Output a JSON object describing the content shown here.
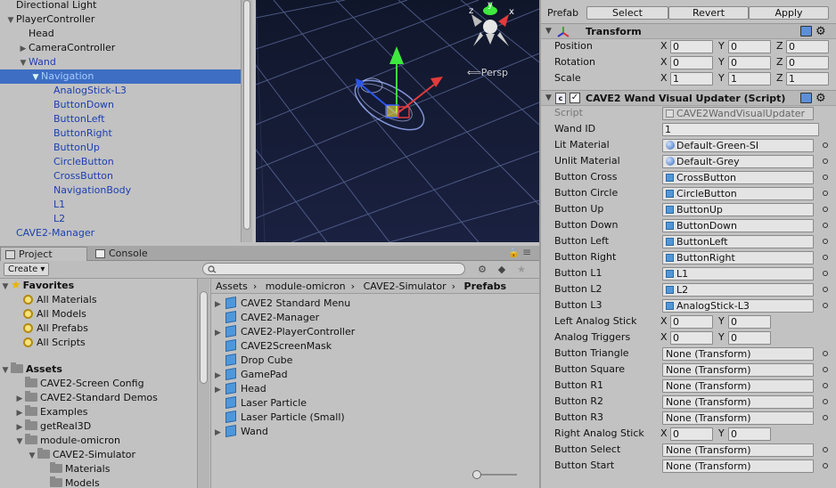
{
  "hierarchy": {
    "items": [
      {
        "label": "Directional Light",
        "indent": 0,
        "arrow": "",
        "selected": false,
        "blue": false
      },
      {
        "label": "PlayerController",
        "indent": 0,
        "arrow": "▼",
        "selected": false,
        "blue": false
      },
      {
        "label": "Head",
        "indent": 1,
        "arrow": "",
        "selected": false,
        "blue": false
      },
      {
        "label": "CameraController",
        "indent": 1,
        "arrow": "▶",
        "selected": false,
        "blue": false
      },
      {
        "label": "Wand",
        "indent": 1,
        "arrow": "▼",
        "selected": false,
        "blue": true
      },
      {
        "label": "Navigation",
        "indent": 2,
        "arrow": "▼",
        "selected": true,
        "blue": true
      },
      {
        "label": "AnalogStick-L3",
        "indent": 3,
        "arrow": "",
        "selected": false,
        "blue": true
      },
      {
        "label": "ButtonDown",
        "indent": 3,
        "arrow": "",
        "selected": false,
        "blue": true
      },
      {
        "label": "ButtonLeft",
        "indent": 3,
        "arrow": "",
        "selected": false,
        "blue": true
      },
      {
        "label": "ButtonRight",
        "indent": 3,
        "arrow": "",
        "selected": false,
        "blue": true
      },
      {
        "label": "ButtonUp",
        "indent": 3,
        "arrow": "",
        "selected": false,
        "blue": true
      },
      {
        "label": "CircleButton",
        "indent": 3,
        "arrow": "",
        "selected": false,
        "blue": true
      },
      {
        "label": "CrossButton",
        "indent": 3,
        "arrow": "",
        "selected": false,
        "blue": true
      },
      {
        "label": "NavigationBody",
        "indent": 3,
        "arrow": "",
        "selected": false,
        "blue": true
      },
      {
        "label": "L1",
        "indent": 3,
        "arrow": "",
        "selected": false,
        "blue": true
      },
      {
        "label": "L2",
        "indent": 3,
        "arrow": "",
        "selected": false,
        "blue": true
      },
      {
        "label": "CAVE2-Manager",
        "indent": 0,
        "arrow": "",
        "selected": false,
        "blue": true
      }
    ]
  },
  "scene": {
    "persp_label": "Persp",
    "gizmo_y": "y",
    "gizmo_x": "x",
    "gizmo_z": "z"
  },
  "project": {
    "tabs": {
      "project": "Project",
      "console": "Console"
    },
    "create_label": "Create",
    "favorites": {
      "title": "Favorites",
      "items": [
        "All Materials",
        "All Models",
        "All Prefabs",
        "All Scripts"
      ]
    },
    "assets": {
      "title": "Assets",
      "items": [
        {
          "label": "CAVE2-Screen Config",
          "indent": 1,
          "arrow": ""
        },
        {
          "label": "CAVE2-Standard Demos",
          "indent": 1,
          "arrow": "▶"
        },
        {
          "label": "Examples",
          "indent": 1,
          "arrow": "▶"
        },
        {
          "label": "getReal3D",
          "indent": 1,
          "arrow": "▶"
        },
        {
          "label": "module-omicron",
          "indent": 1,
          "arrow": "▼"
        },
        {
          "label": "CAVE2-Simulator",
          "indent": 2,
          "arrow": "▼"
        },
        {
          "label": "Materials",
          "indent": 3,
          "arrow": ""
        },
        {
          "label": "Models",
          "indent": 3,
          "arrow": ""
        }
      ]
    },
    "breadcrumb": [
      "Assets",
      "module-omicron",
      "CAVE2-Simulator",
      "Prefabs"
    ],
    "files": [
      {
        "label": "CAVE2 Standard Menu",
        "arrow": "▶"
      },
      {
        "label": "CAVE2-Manager",
        "arrow": ""
      },
      {
        "label": "CAVE2-PlayerController",
        "arrow": "▶"
      },
      {
        "label": "CAVE2ScreenMask",
        "arrow": ""
      },
      {
        "label": "Drop Cube",
        "arrow": ""
      },
      {
        "label": "GamePad",
        "arrow": "▶"
      },
      {
        "label": "Head",
        "arrow": "▶"
      },
      {
        "label": "Laser Particle",
        "arrow": ""
      },
      {
        "label": "Laser Particle (Small)",
        "arrow": ""
      },
      {
        "label": "Wand",
        "arrow": "▶"
      }
    ]
  },
  "inspector": {
    "prefab_label": "Prefab",
    "select_label": "Select",
    "revert_label": "Revert",
    "apply_label": "Apply",
    "transform": {
      "title": "Transform",
      "rows": [
        {
          "label": "Position",
          "x": "0",
          "y": "0",
          "z": "0"
        },
        {
          "label": "Rotation",
          "x": "0",
          "y": "0",
          "z": "0"
        },
        {
          "label": "Scale",
          "x": "1",
          "y": "1",
          "z": "1"
        }
      ]
    },
    "script_component": {
      "title": "CAVE2 Wand Visual Updater (Script)",
      "script_label": "Script",
      "script_value": "CAVE2WandVisualUpdater",
      "wand_id_label": "Wand ID",
      "wand_id_value": "1"
    },
    "fields": [
      {
        "label": "Lit Material",
        "value": "Default-Green-SI",
        "kind": "mat"
      },
      {
        "label": "Unlit Material",
        "value": "Default-Grey",
        "kind": "mat"
      },
      {
        "label": "Button Cross",
        "value": "CrossButton",
        "kind": "obj"
      },
      {
        "label": "Button Circle",
        "value": "CircleButton",
        "kind": "obj"
      },
      {
        "label": "Button Up",
        "value": "ButtonUp",
        "kind": "obj"
      },
      {
        "label": "Button Down",
        "value": "ButtonDown",
        "kind": "obj"
      },
      {
        "label": "Button Left",
        "value": "ButtonLeft",
        "kind": "obj"
      },
      {
        "label": "Button Right",
        "value": "ButtonRight",
        "kind": "obj"
      },
      {
        "label": "Button L1",
        "value": "L1",
        "kind": "obj"
      },
      {
        "label": "Button L2",
        "value": "L2",
        "kind": "obj"
      },
      {
        "label": "Button L3",
        "value": "AnalogStick-L3",
        "kind": "obj"
      },
      {
        "label": "Left Analog Stick",
        "x": "0",
        "y": "0",
        "kind": "vec"
      },
      {
        "label": "Analog Triggers",
        "x": "0",
        "y": "0",
        "kind": "vec"
      },
      {
        "label": "Button Triangle",
        "value": "None (Transform)",
        "kind": "none"
      },
      {
        "label": "Button Square",
        "value": "None (Transform)",
        "kind": "none"
      },
      {
        "label": "Button R1",
        "value": "None (Transform)",
        "kind": "none"
      },
      {
        "label": "Button R2",
        "value": "None (Transform)",
        "kind": "none"
      },
      {
        "label": "Button R3",
        "value": "None (Transform)",
        "kind": "none"
      },
      {
        "label": "Right Analog Stick",
        "x": "0",
        "y": "0",
        "kind": "vec"
      },
      {
        "label": "Button Select",
        "value": "None (Transform)",
        "kind": "none"
      },
      {
        "label": "Button Start",
        "value": "None (Transform)",
        "kind": "none"
      }
    ]
  }
}
